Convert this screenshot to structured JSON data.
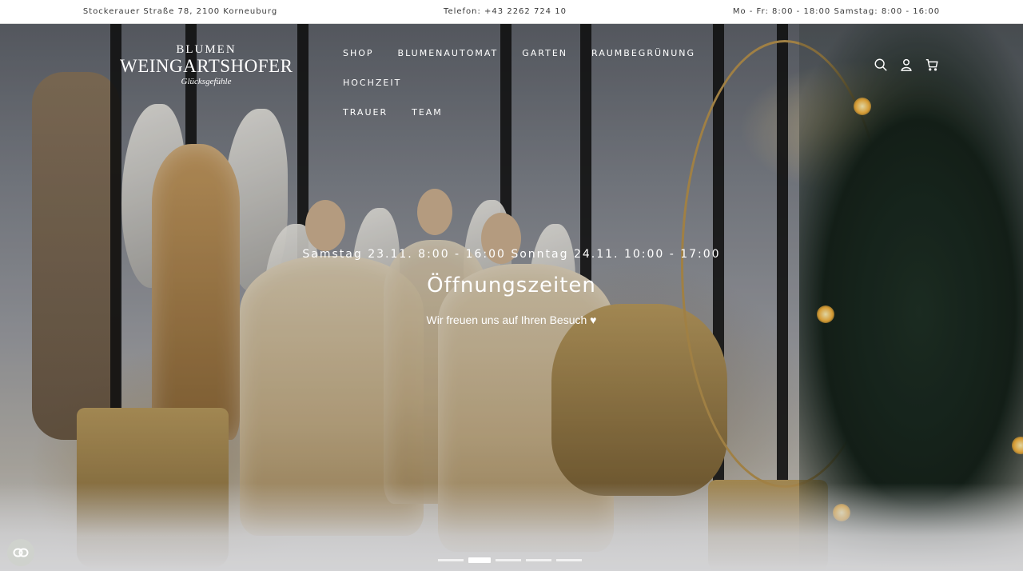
{
  "announcement_bar": {
    "address": "Stockerauer Straße 78, 2100 Korneuburg",
    "phone": "Telefon: +43 2262 724 10",
    "hours": "Mo - Fr: 8:00 - 18:00 Samstag: 8:00 - 16:00"
  },
  "logo": {
    "line1": "BLUMEN",
    "line2": "WEINGARTSHOFER",
    "line3": "Glücksgefühle"
  },
  "nav": {
    "items": [
      {
        "label": "SHOP"
      },
      {
        "label": "BLUMENAUTOMAT"
      },
      {
        "label": "GARTEN"
      },
      {
        "label": "RAUMBEGRÜNUNG"
      },
      {
        "label": "HOCHZEIT"
      },
      {
        "label": "TRAUER"
      },
      {
        "label": "TEAM"
      }
    ]
  },
  "header_icons": [
    "search-icon",
    "account-icon",
    "cart-icon"
  ],
  "hero": {
    "subheading": "Samstag 23.11. 8:00 - 16:00 Sonntag 24.11. 10:00 - 17:00",
    "heading": "Öffnungszeiten",
    "text": "Wir freuen uns auf Ihren Besuch ♥",
    "slide_count": 5,
    "active_slide": 2
  },
  "colors": {
    "text_light": "#ffffff",
    "announcement_text": "#3a3a3a"
  }
}
